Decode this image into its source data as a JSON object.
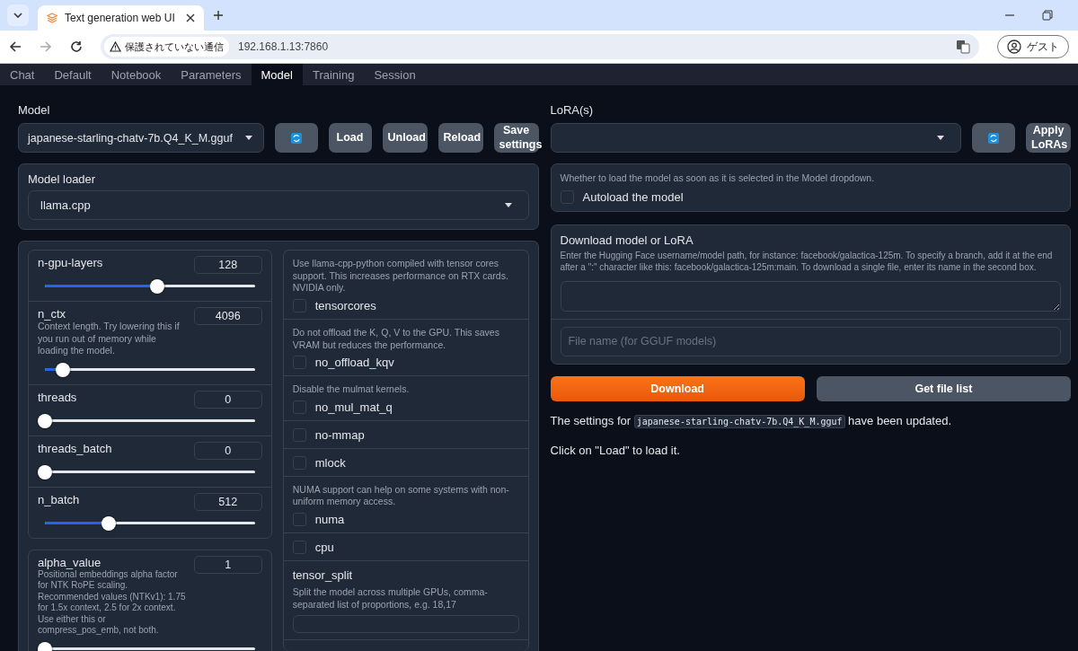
{
  "browser": {
    "tab_title": "Text generation web UI",
    "security": "保護されていない通信",
    "url": "192.168.1.13:7860",
    "profile": "ゲスト"
  },
  "tabs": [
    {
      "label": "Chat",
      "selected": false
    },
    {
      "label": "Default",
      "selected": false
    },
    {
      "label": "Notebook",
      "selected": false
    },
    {
      "label": "Parameters",
      "selected": false
    },
    {
      "label": "Model",
      "selected": true
    },
    {
      "label": "Training",
      "selected": false
    },
    {
      "label": "Session",
      "selected": false
    }
  ],
  "model": {
    "label": "Model",
    "value": "japanese-starling-chatv-7b.Q4_K_M.gguf",
    "buttons": [
      "Load",
      "Unload",
      "Reload",
      "Save settings"
    ]
  },
  "lora": {
    "label": "LoRA(s)",
    "button": "Apply LoRAs"
  },
  "loader": {
    "label": "Model loader",
    "value": "llama.cpp"
  },
  "sliders": [
    {
      "label": "n-gpu-layers",
      "value": "128",
      "level": 0.5
    },
    {
      "label": "n_ctx",
      "value": "4096",
      "description": "Context length. Try lowering this if you run out of memory while loading the model.",
      "level": 0.05
    },
    {
      "label": "threads",
      "value": "0",
      "level": 0
    },
    {
      "label": "threads_batch",
      "value": "0",
      "level": 0
    },
    {
      "label": "n_batch",
      "value": "512",
      "level": 0.27
    }
  ],
  "alpha": {
    "label": "alpha_value",
    "value": "1",
    "description": "Positional embeddings alpha factor for NTK RoPE scaling. Recommended values (NTKv1): 1.75 for 1.5x context, 2.5 for 2x context. Use either this or compress_pos_emb, not both.",
    "level": 0
  },
  "checkboxes": [
    {
      "description": "Use llama-cpp-python compiled with tensor cores support. This increases performance on RTX cards. NVIDIA only.",
      "label": "tensorcores",
      "checked": false
    },
    {
      "description": "Do not offload the K, Q, V to the GPU. This saves VRAM but reduces the performance.",
      "label": "no_offload_kqv",
      "checked": false
    },
    {
      "description": "Disable the mulmat kernels.",
      "label": "no_mul_mat_q",
      "checked": false
    },
    {
      "label": "no-mmap",
      "checked": false
    },
    {
      "label": "mlock",
      "checked": false
    },
    {
      "description": "NUMA support can help on some systems with non-uniform memory access.",
      "label": "numa",
      "checked": false
    },
    {
      "label": "cpu",
      "checked": false
    }
  ],
  "tensor_split": {
    "label": "tensor_split",
    "description": "Split the model across multiple GPUs, comma-separated list of proportions, e.g. 18,17"
  },
  "autoload": {
    "description": "Whether to load the model as soon as it is selected in the Model dropdown.",
    "label": "Autoload the model",
    "checked": false
  },
  "download": {
    "title": "Download model or LoRA",
    "description": "Enter the Hugging Face username/model path, for instance: facebook/galactica-125m. To specify a branch, add it at the end after a \":\" character like this: facebook/galactica-125m:main. To download a single file, enter its name in the second box.",
    "placeholder": "File name (for GGUF models)",
    "buttons": [
      "Download",
      "Get file list"
    ]
  },
  "status": {
    "prefix": "The settings for",
    "code": "japanese-starling-chatv-7b.Q4_K_M.gguf",
    "suffix": "have been updated.",
    "note": "Click on \"Load\" to load it."
  }
}
